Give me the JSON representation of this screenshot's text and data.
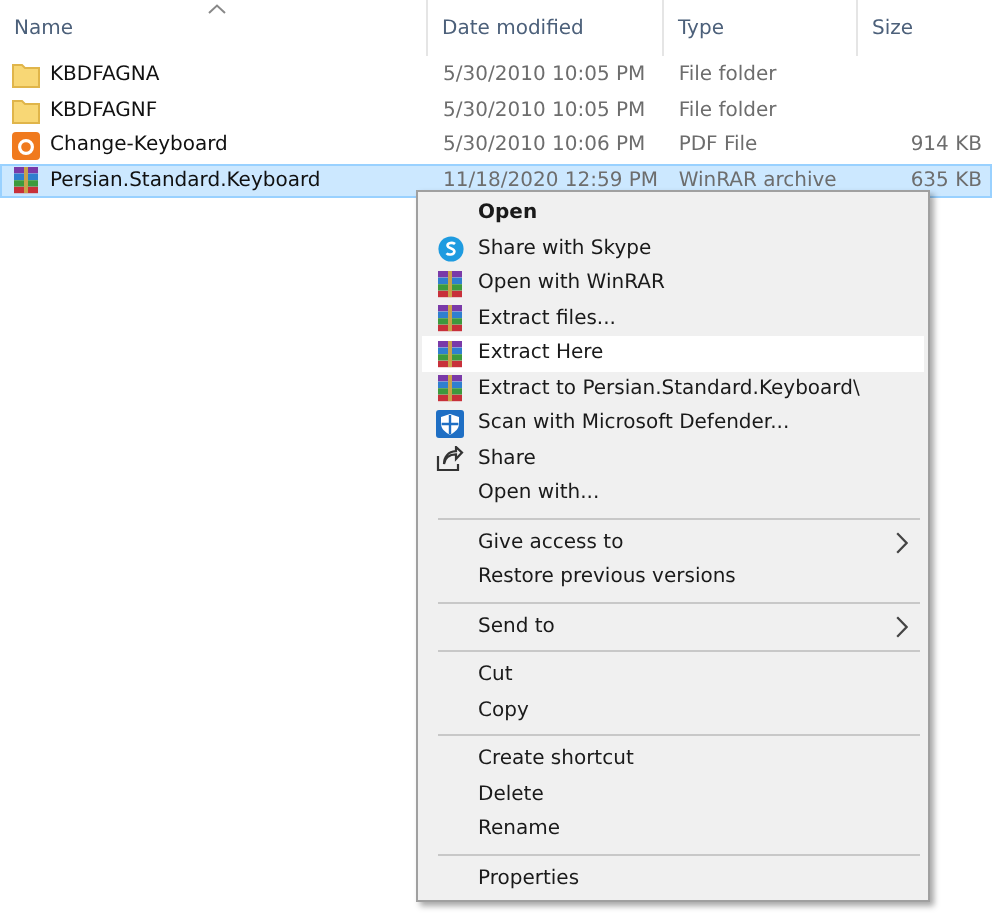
{
  "columns": [
    {
      "label": "Name",
      "sorted": true
    },
    {
      "label": "Date modified",
      "sorted": false
    },
    {
      "label": "Type",
      "sorted": false
    },
    {
      "label": "Size",
      "sorted": false
    }
  ],
  "files": [
    {
      "kind": "folder",
      "name": "KBDFAGNA",
      "date": "5/30/2010 10:05 PM",
      "type": "File folder",
      "selected": false
    },
    {
      "kind": "folder",
      "name": "KBDFAGNF",
      "date": "5/30/2010 10:05 PM",
      "type": "File folder",
      "selected": false
    },
    {
      "kind": "pdf",
      "name": "Change-Keyboard",
      "date": "5/30/2010 10:06 PM",
      "type": "PDF File",
      "size": "914 KB",
      "selected": false
    },
    {
      "kind": "archive",
      "name": "Persian.Standard.Keyboard",
      "date": "11/18/2020 12:59 PM",
      "type": "WinRAR archive",
      "size": "635 KB",
      "selected": true
    }
  ],
  "context_menu": [
    {
      "kind": "plain",
      "label": "Open",
      "bold": true,
      "submenu": false,
      "selected": false
    },
    {
      "kind": "skype",
      "label": "Share with Skype",
      "bold": false,
      "submenu": false,
      "selected": false
    },
    {
      "kind": "archive",
      "label": "Open with WinRAR",
      "bold": false,
      "submenu": false,
      "selected": false
    },
    {
      "kind": "archive",
      "label": "Extract files...",
      "bold": false,
      "submenu": false,
      "selected": false
    },
    {
      "kind": "archive",
      "label": "Extract Here",
      "bold": false,
      "submenu": false,
      "selected": true
    },
    {
      "kind": "archive",
      "label": "Extract to Persian.Standard.Keyboard\\",
      "bold": false,
      "submenu": false,
      "selected": false
    },
    {
      "kind": "shield",
      "label": "Scan with Microsoft Defender...",
      "bold": false,
      "submenu": false,
      "selected": false
    },
    {
      "kind": "share",
      "label": "Share",
      "bold": false,
      "submenu": false,
      "selected": false
    },
    {
      "kind": "plain",
      "label": "Open with...",
      "bold": false,
      "submenu": false,
      "selected": false
    },
    {
      "kind": "separator"
    },
    {
      "kind": "plain",
      "label": "Give access to",
      "bold": false,
      "submenu": true,
      "selected": false
    },
    {
      "kind": "plain",
      "label": "Restore previous versions",
      "bold": false,
      "submenu": false,
      "selected": false
    },
    {
      "kind": "separator"
    },
    {
      "kind": "plain",
      "label": "Send to",
      "bold": false,
      "submenu": true,
      "selected": false
    },
    {
      "kind": "separator"
    },
    {
      "kind": "plain",
      "label": "Cut",
      "bold": false,
      "submenu": false,
      "selected": false
    },
    {
      "kind": "plain",
      "label": "Copy",
      "bold": false,
      "submenu": false,
      "selected": false
    },
    {
      "kind": "separator"
    },
    {
      "kind": "plain",
      "label": "Create shortcut",
      "bold": false,
      "submenu": false,
      "selected": false
    },
    {
      "kind": "plain",
      "label": "Delete",
      "bold": false,
      "submenu": false,
      "selected": false
    },
    {
      "kind": "plain",
      "label": "Rename",
      "bold": false,
      "submenu": false,
      "selected": false
    },
    {
      "kind": "separator"
    },
    {
      "kind": "plain",
      "label": "Properties",
      "bold": false,
      "submenu": false,
      "selected": false
    }
  ]
}
